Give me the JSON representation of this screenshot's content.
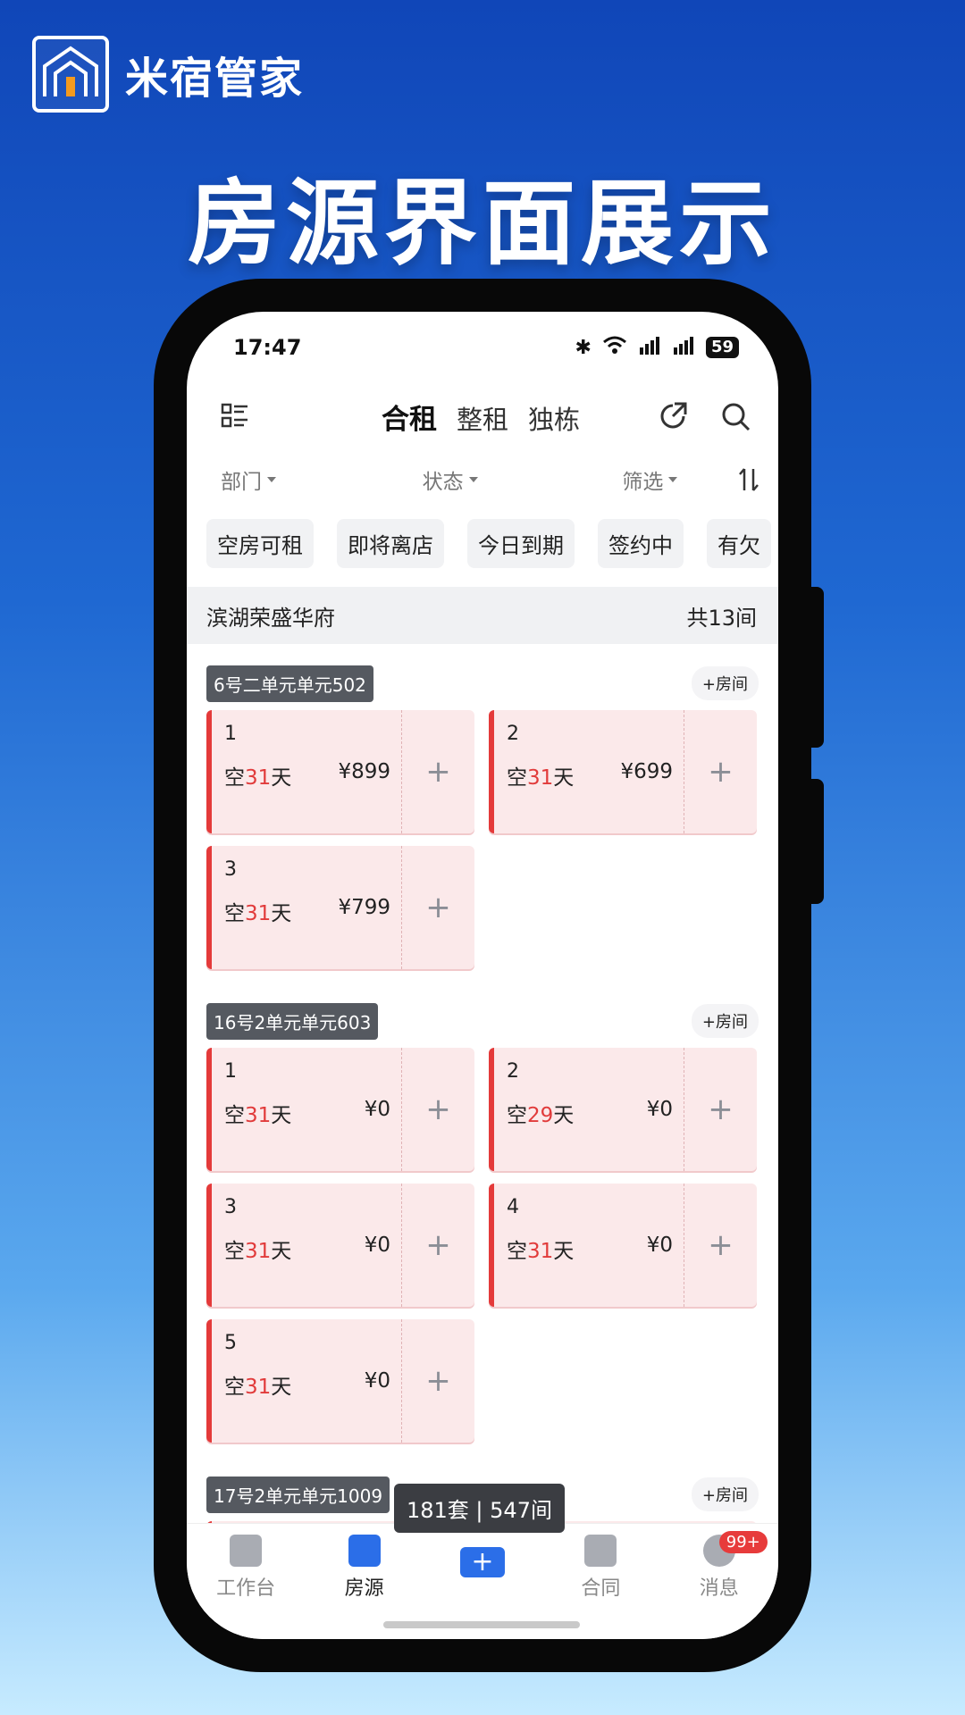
{
  "brand": {
    "name": "米宿管家"
  },
  "headline": "房源界面展示",
  "status_bar": {
    "time": "17:47",
    "battery": "59"
  },
  "header": {
    "tabs": [
      {
        "label": "合租"
      },
      {
        "label": "整租"
      },
      {
        "label": "独栋"
      }
    ]
  },
  "filters": [
    {
      "label": "部门"
    },
    {
      "label": "状态"
    },
    {
      "label": "筛选"
    }
  ],
  "chips": [
    {
      "label": "空房可租"
    },
    {
      "label": "即将离店"
    },
    {
      "label": "今日到期"
    },
    {
      "label": "签约中"
    },
    {
      "label": "有欠"
    }
  ],
  "building": {
    "name": "滨湖荣盛华府",
    "count": "共13间"
  },
  "add_room_label": "+房间",
  "units": [
    {
      "name": "6号二单元单元502",
      "rooms": [
        {
          "no": "1",
          "state_prefix": "空",
          "days": "31",
          "state_suffix": "天",
          "price": "¥899"
        },
        {
          "no": "2",
          "state_prefix": "空",
          "days": "31",
          "state_suffix": "天",
          "price": "¥699"
        },
        {
          "no": "3",
          "state_prefix": "空",
          "days": "31",
          "state_suffix": "天",
          "price": "¥799"
        }
      ]
    },
    {
      "name": "16号2单元单元603",
      "rooms": [
        {
          "no": "1",
          "state_prefix": "空",
          "days": "31",
          "state_suffix": "天",
          "price": "¥0"
        },
        {
          "no": "2",
          "state_prefix": "空",
          "days": "29",
          "state_suffix": "天",
          "price": "¥0"
        },
        {
          "no": "3",
          "state_prefix": "空",
          "days": "31",
          "state_suffix": "天",
          "price": "¥0"
        },
        {
          "no": "4",
          "state_prefix": "空",
          "days": "31",
          "state_suffix": "天",
          "price": "¥0"
        },
        {
          "no": "5",
          "state_prefix": "空",
          "days": "31",
          "state_suffix": "天",
          "price": "¥0"
        }
      ]
    },
    {
      "name": "17号2单元单元1009",
      "rooms": []
    }
  ],
  "toast": "181套 | 547间",
  "bottom_nav": [
    {
      "label": "工作台",
      "icon": "workbench-icon"
    },
    {
      "label": "房源",
      "icon": "listings-icon"
    },
    {
      "label": "",
      "icon": "plus-icon"
    },
    {
      "label": "合同",
      "icon": "contract-icon"
    },
    {
      "label": "消息",
      "icon": "message-icon",
      "badge": "99+"
    }
  ],
  "colors": {
    "accent": "#2b6ee8",
    "vacant": "#e43a3a",
    "card_bg": "#fbe9ea"
  }
}
